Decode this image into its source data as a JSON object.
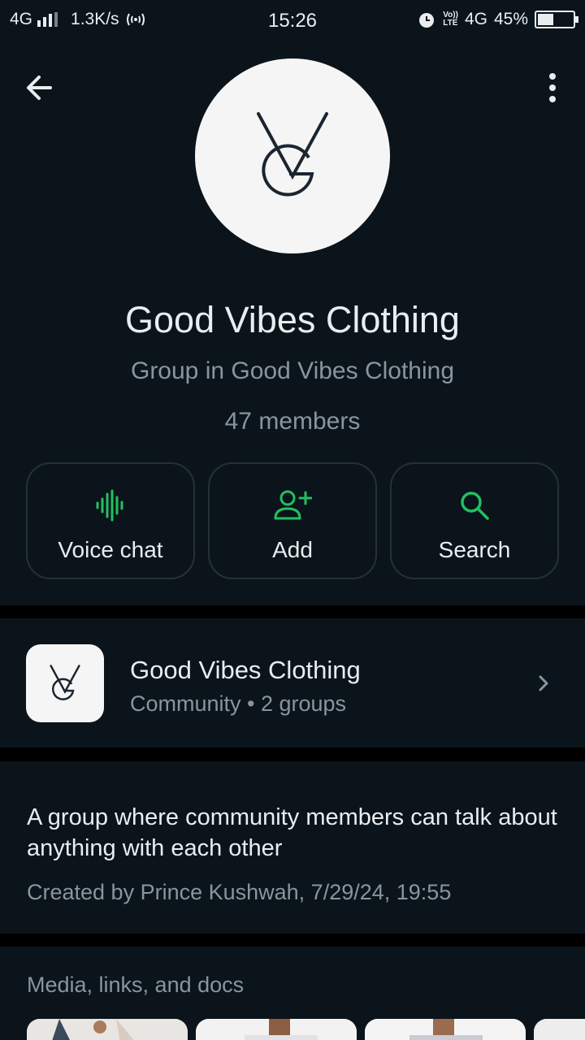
{
  "status_bar": {
    "network": "4G",
    "speed": "1.3K/s",
    "time": "15:26",
    "lte_top": "Vo))",
    "lte_bottom": "LTE",
    "network_right": "4G",
    "battery": "45%",
    "battery_level": 0.45
  },
  "header": {
    "back_icon": "arrow-left-icon",
    "more_icon": "more-vertical-icon",
    "group_name": "Good Vibes Clothing",
    "group_sub": "Group in Good Vibes Clothing",
    "members": "47 members"
  },
  "actions": [
    {
      "label": "Voice chat",
      "icon": "voice-wave-icon"
    },
    {
      "label": "Add",
      "icon": "add-person-icon"
    },
    {
      "label": "Search",
      "icon": "search-icon"
    }
  ],
  "community": {
    "name": "Good Vibes Clothing",
    "meta": "Community • 2 groups"
  },
  "description": {
    "text": "A group where community members can talk about anything with each other",
    "created": "Created by Prince Kushwah, 7/29/24, 19:55"
  },
  "media": {
    "title": "Media, links, and docs"
  },
  "colors": {
    "accent": "#21c063",
    "background": "#0b141a",
    "secondary_text": "#8696a0"
  }
}
